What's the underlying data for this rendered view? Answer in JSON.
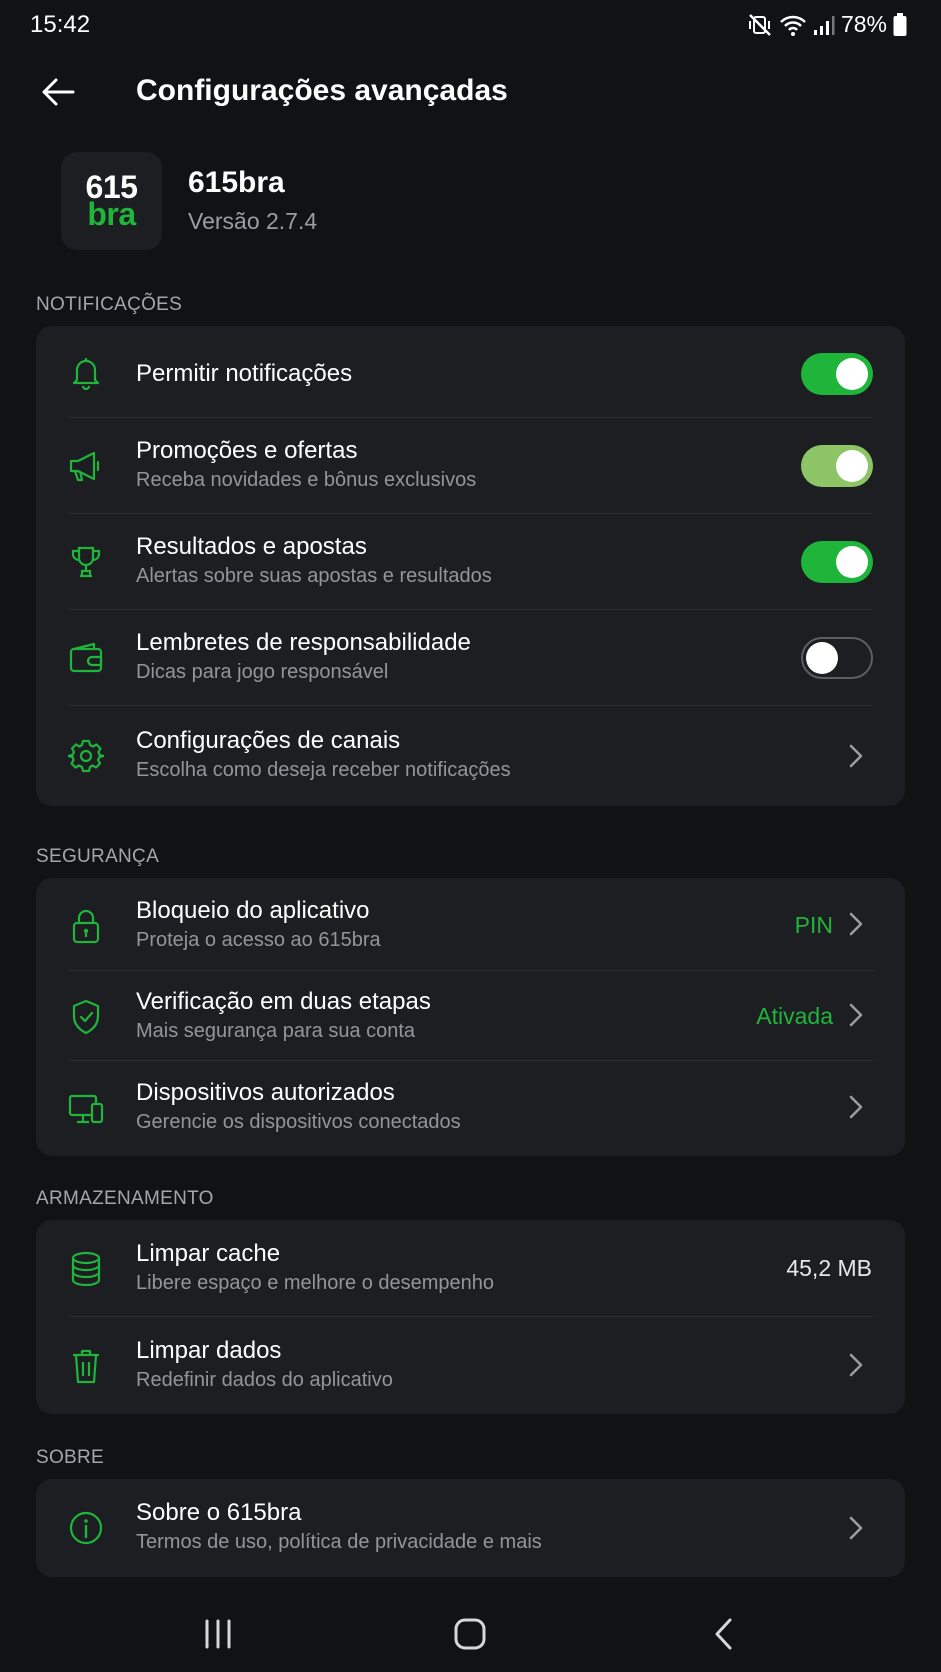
{
  "status": {
    "time": "15:42",
    "battery": "78%"
  },
  "appbar": {
    "title": "Configurações avançadas"
  },
  "app": {
    "logo_top": "615",
    "logo_bottom": "bra",
    "name": "615bra",
    "version": "Versão 2.7.4"
  },
  "colors": {
    "accent": "#1fb53b",
    "background": "#111214",
    "card": "#1c1e22"
  },
  "notifications": {
    "label": "NOTIFICAÇÕES",
    "items": [
      {
        "title": "Permitir notificações",
        "subtitle": "",
        "icon": "bell-icon",
        "toggle": "on"
      },
      {
        "title": "Promoções e ofertas",
        "subtitle": "Receba novidades e bônus exclusivos",
        "icon": "megaphone-icon",
        "toggle": "on"
      },
      {
        "title": "Resultados e apostas",
        "subtitle": "Alertas sobre suas apostas e resultados",
        "icon": "trophy-icon",
        "toggle": "on"
      },
      {
        "title": "Lembretes de responsabilidade",
        "subtitle": "Dicas para jogo responsável",
        "icon": "wallet-icon",
        "toggle": "off"
      },
      {
        "title": "Configurações de canais",
        "subtitle": "Escolha como deseja receber notificações",
        "icon": "gear-icon"
      }
    ]
  },
  "security": {
    "label": "SEGURANÇA",
    "items": [
      {
        "title": "Bloqueio do aplicativo",
        "subtitle": "Proteja o acesso ao 615bra",
        "value": "PIN",
        "icon": "lock-icon"
      },
      {
        "title": "Verificação em duas etapas",
        "subtitle": "Mais segurança para sua conta",
        "value": "Ativada",
        "icon": "shield-icon"
      },
      {
        "title": "Dispositivos autorizados",
        "subtitle": "Gerencie os dispositivos conectados",
        "icon": "devices-icon"
      }
    ]
  },
  "storage": {
    "label": "ARMAZENAMENTO",
    "items": [
      {
        "title": "Limpar cache",
        "subtitle": "Libere espaço e melhore o desempenho",
        "value": "45,2 MB",
        "icon": "database-icon"
      },
      {
        "title": "Limpar dados",
        "subtitle": "Redefinir dados do aplicativo",
        "icon": "trash-icon"
      }
    ]
  },
  "about": {
    "label": "SOBRE",
    "items": [
      {
        "title": "Sobre o 615bra",
        "subtitle": "Termos de uso, política de privacidade e mais",
        "icon": "info-icon"
      }
    ]
  }
}
